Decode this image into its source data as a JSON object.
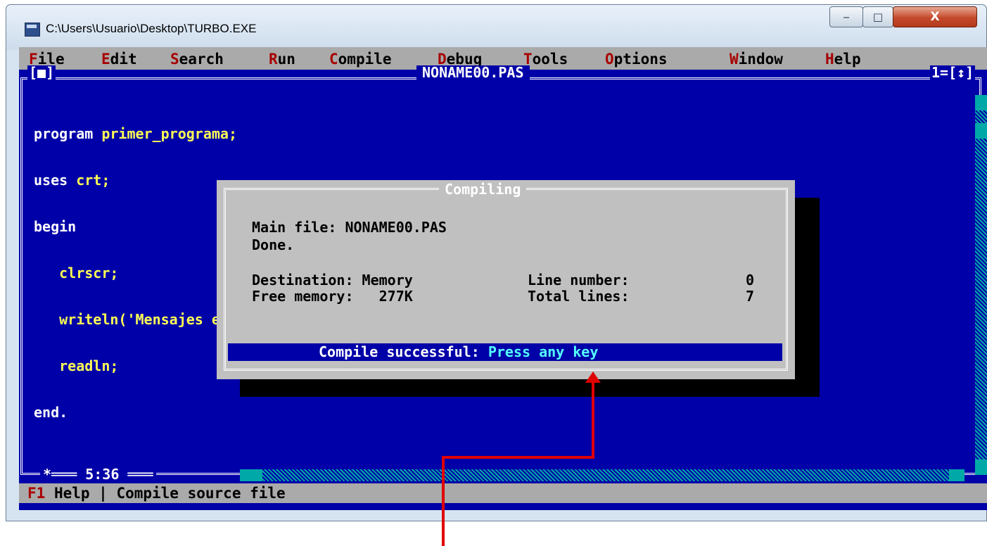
{
  "window": {
    "title": "C:\\Users\\Usuario\\Desktop\\TURBO.EXE",
    "controls": {
      "minimize": "‒",
      "maximize": "□",
      "close": "X"
    }
  },
  "menubar": [
    {
      "hotkey": "F",
      "rest": "ile"
    },
    {
      "hotkey": "E",
      "rest": "dit"
    },
    {
      "hotkey": "S",
      "rest": "earch"
    },
    {
      "hotkey": "R",
      "rest": "un"
    },
    {
      "hotkey": "C",
      "rest": "ompile"
    },
    {
      "pre": "",
      "hotkey": "D",
      "rest": "ebug"
    },
    {
      "hotkey": "T",
      "rest": "ools"
    },
    {
      "hotkey": "O",
      "rest": "ptions"
    },
    {
      "hotkey": "W",
      "rest": "indow"
    },
    {
      "hotkey": "H",
      "rest": "elp"
    }
  ],
  "editor": {
    "file_title": "NONAME00.PAS",
    "close_box": "[■]",
    "window_number": "1=[↕]",
    "cursor_position": "5:36",
    "code": [
      {
        "kw": "program ",
        "id": "primer_programa;"
      },
      {
        "kw": "uses ",
        "id": "crt;"
      },
      {
        "kw": "begin",
        "id": ""
      },
      {
        "kw": "   ",
        "id": "clrscr;"
      },
      {
        "kw": "   ",
        "id": "writeln('Mensajes en pantalla');"
      },
      {
        "kw": "   ",
        "id": "readln;"
      },
      {
        "kw": "end.",
        "id": ""
      }
    ]
  },
  "dialog": {
    "title": "Compiling",
    "main_file": "Main file: NONAME00.PAS",
    "done": "Done.",
    "destination": "Destination: Memory",
    "free_memory": "Free memory:   277K",
    "line_number_label": "Line number:",
    "line_number_value": "0",
    "total_lines_label": "Total lines:",
    "total_lines_value": "7",
    "status_prefix": "Compile successful: ",
    "status_action": "Press any key"
  },
  "statusbar": {
    "hotkey": "F1",
    "help": " Help",
    "separator": " | ",
    "hint": "Compile source file"
  },
  "colors": {
    "dos_blue": "#0000a8",
    "dos_gray": "#aaaaaa",
    "hotkey_red": "#a80000",
    "code_yellow": "#ffff55",
    "annotation_red": "#e00000"
  }
}
